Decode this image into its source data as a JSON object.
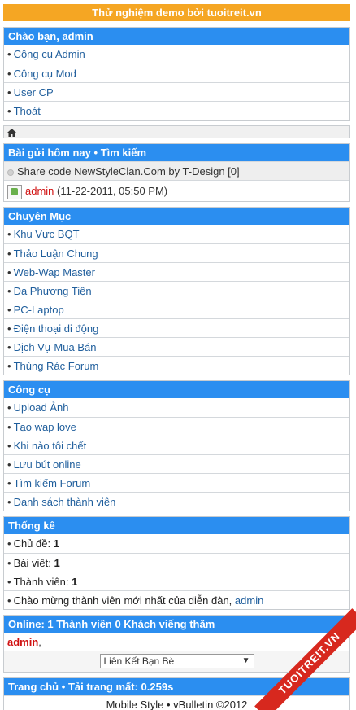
{
  "banner": "Thử nghiệm demo bởi tuoitreit.vn",
  "user_box": {
    "title": "Chào bạn, admin",
    "items": [
      "Công cụ Admin",
      "Công cụ Mod",
      "User CP",
      "Thoát"
    ]
  },
  "posts_box": {
    "title_left": "Bài gửi hôm nay",
    "separator": "•",
    "title_right": "Tìm kiếm",
    "post_title": "Share code NewStyleClan.Com by T-Design [0]",
    "post_user": "admin",
    "post_date": "(11-22-2011, 05:50 PM)"
  },
  "categories": {
    "title": "Chuyên Mục",
    "items": [
      "Khu Vực BQT",
      "Thảo Luận Chung",
      "Web-Wap Master",
      "Đa Phương Tiện",
      "PC-Laptop",
      "Điện thoại di động",
      "Dịch Vụ-Mua Bán",
      "Thùng Rác Forum"
    ]
  },
  "tools": {
    "title": "Công cụ",
    "items": [
      "Upload Ảnh",
      "Tạo wap love",
      "Khi nào tôi chết",
      "Lưu bút online",
      "Tìm kiếm Forum",
      "Danh sách thành viên"
    ]
  },
  "stats": {
    "title": "Thống kê",
    "topics_label": "Chủ đề:",
    "topics_value": "1",
    "posts_label": "Bài viết:",
    "posts_value": "1",
    "members_label": "Thành viên:",
    "members_value": "1",
    "newest_label": "Chào mừng thành viên mới nhất của diễn đàn,",
    "newest_user": "admin"
  },
  "online": {
    "title": "Online: 1 Thành viên 0 Khách viếng thăm",
    "user": "admin",
    "user_suffix": ",",
    "select_value": "Liên Kết Bạn Bè"
  },
  "footer": {
    "home": "Trang chủ",
    "separator": "•",
    "load_label": "Tải trang mất:",
    "load_value": "0.259s",
    "credit": "Mobile Style • vBulletin ©2012"
  },
  "watermark": "TUOITREIT.VN",
  "icons": {
    "home": "home-icon"
  }
}
